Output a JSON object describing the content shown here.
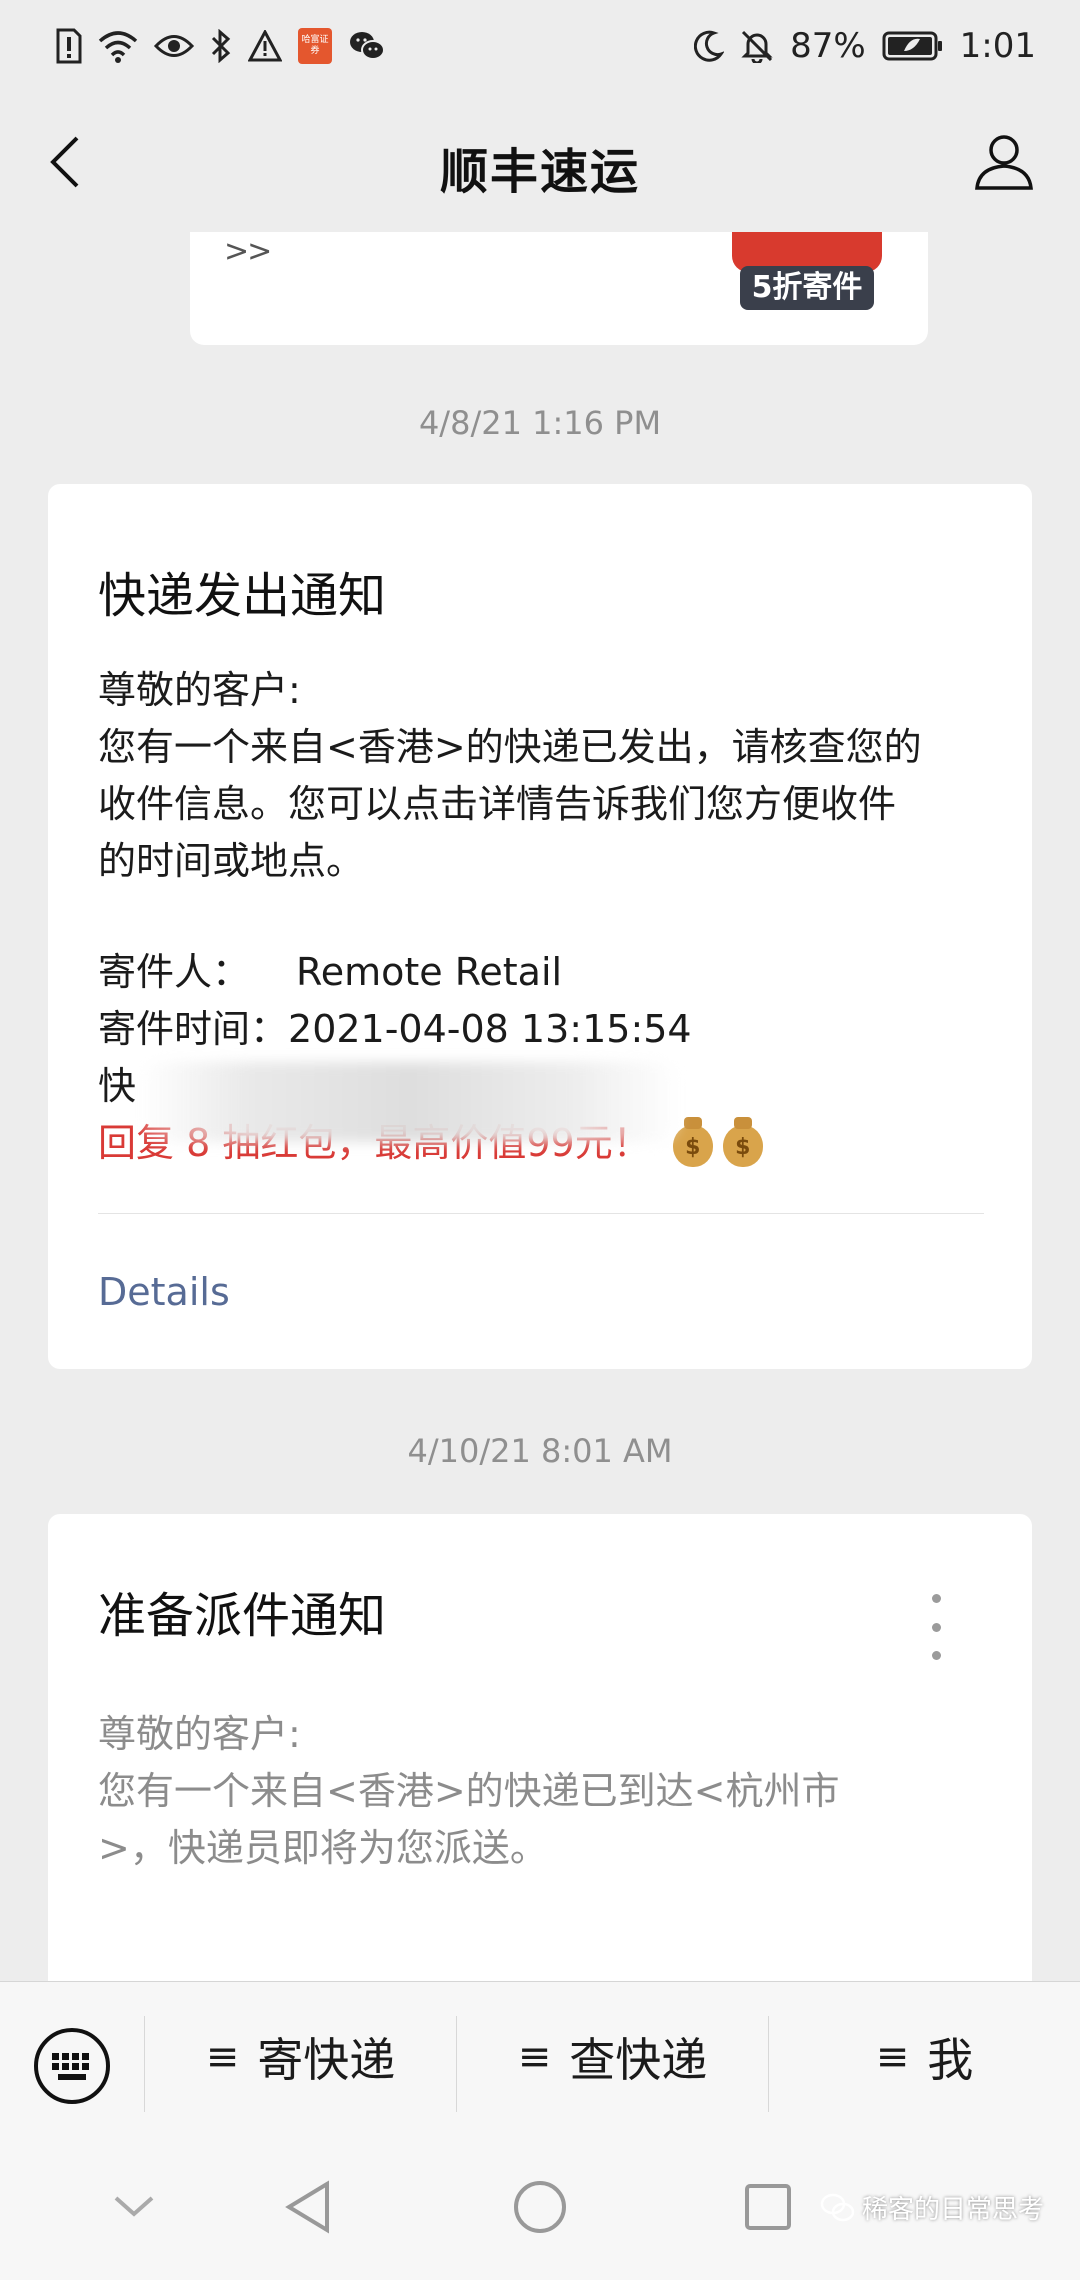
{
  "status_bar": {
    "app_badge": "哈富证券",
    "battery": "87%",
    "time": "1:01"
  },
  "header": {
    "title": "顺丰速运"
  },
  "prev_card": {
    "arrows": ">>",
    "promo_badge": "5折寄件"
  },
  "messages": [
    {
      "timestamp": "4/8/21 1:16 PM",
      "title": "快递发出通知",
      "greeting": "尊敬的客户:",
      "body_lines": [
        "您有一个来自<香港>的快递已发出，请核查您的",
        "收件信息。您可以点击详情告诉我们您方便收件",
        "的时间或地点。"
      ],
      "sender_label": "寄件人：",
      "sender_value": "Remote Retail",
      "time_label": "寄件时间：",
      "time_value": "2021-04-08 13:15:54",
      "tracking_label_partial": "快",
      "promo_text": "回复 8 抽红包，最高价值99元！",
      "details": "Details"
    },
    {
      "timestamp": "4/10/21 8:01 AM",
      "title": "准备派件通知",
      "greeting": "尊敬的客户:",
      "body_lines": [
        "您有一个来自<香港>的快递已到达<杭州市",
        ">，快递员即将为您派送。"
      ]
    }
  ],
  "bottom_menu": {
    "items": [
      {
        "label": "寄快递"
      },
      {
        "label": "查快递"
      },
      {
        "label": "我"
      }
    ],
    "hamburger": "≡"
  },
  "watermark": "稀客的日常思考",
  "colors": {
    "accent_link": "#576b95",
    "promo_red": "#d93a36",
    "background": "#ededed"
  }
}
